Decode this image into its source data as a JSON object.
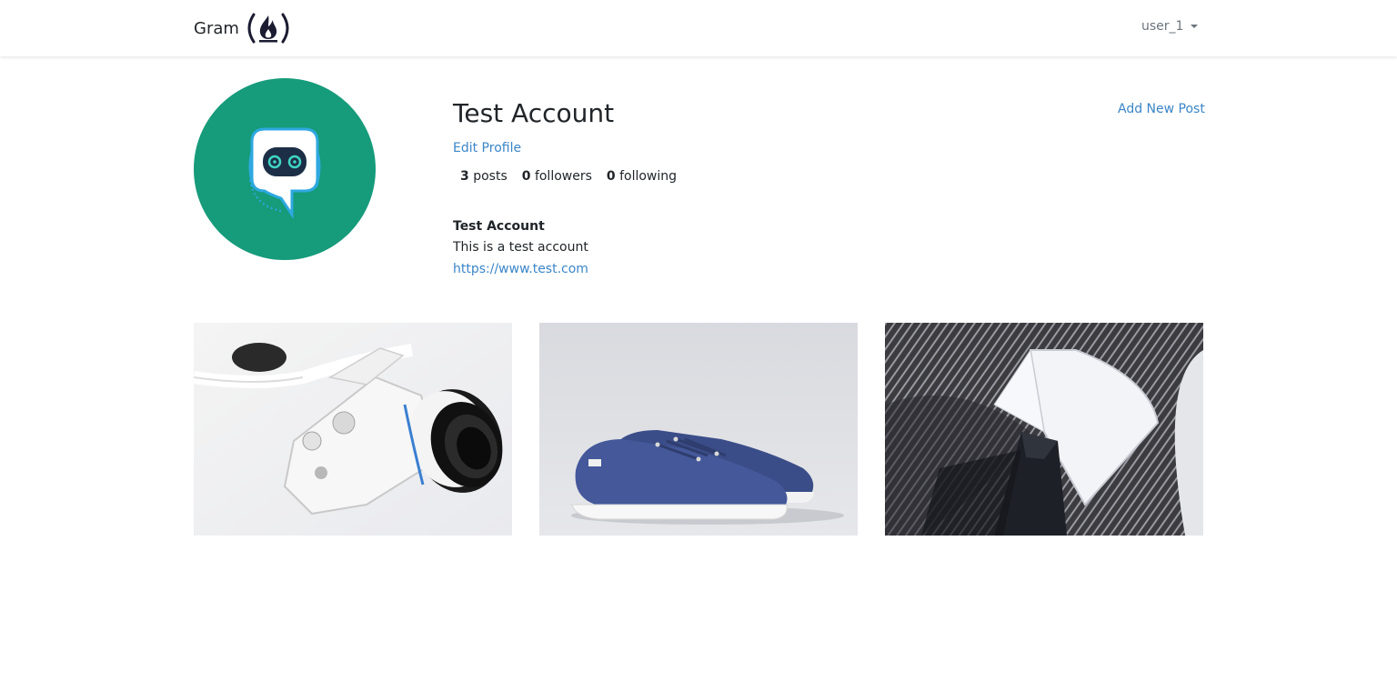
{
  "navbar": {
    "brand_text": "Gram",
    "logo_icon": "freecodecamp-flame-icon",
    "user_menu_label": "user_1"
  },
  "profile": {
    "name": "Test Account",
    "edit_profile_label": "Edit Profile",
    "add_new_post_label": "Add New Post",
    "stats": {
      "posts_count": "3",
      "posts_label": "posts",
      "followers_count": "0",
      "followers_label": "followers",
      "following_count": "0",
      "following_label": "following"
    },
    "bio": {
      "title": "Test Account",
      "description": "This is a test account",
      "url": "https://www.test.com"
    },
    "avatar": {
      "icon": "robot-chat-icon",
      "background_color": "#169b7b"
    }
  },
  "posts": [
    {
      "subject": "camera-photo"
    },
    {
      "subject": "sneakers-photo"
    },
    {
      "subject": "shirt-tie-photo"
    }
  ],
  "colors": {
    "link": "#3a86c8",
    "text": "#212529",
    "muted": "#6c757d"
  }
}
